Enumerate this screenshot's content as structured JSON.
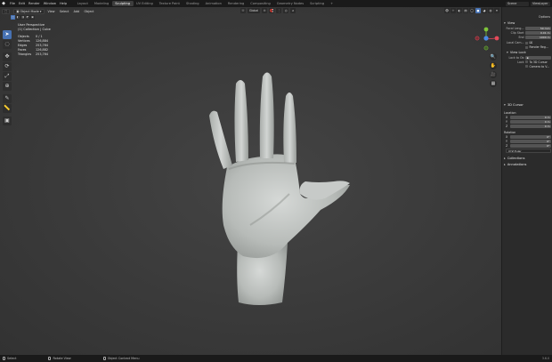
{
  "app": {
    "logo_glyph": "◆",
    "menu": [
      "File",
      "Edit",
      "Render",
      "Window",
      "Help"
    ],
    "workspaces": [
      "Layout",
      "Modeling",
      "Sculpting",
      "UV Editing",
      "Texture Paint",
      "Shading",
      "Animation",
      "Rendering",
      "Compositing",
      "Geometry Nodes",
      "Scripting"
    ],
    "active_workspace_index": 2,
    "add_workspace": "+",
    "scene": "Scene",
    "view_layer": "ViewLayer"
  },
  "viewport_header": {
    "mode": "Object Mode",
    "menus": [
      "View",
      "Select",
      "Add",
      "Object"
    ],
    "transform_orientation": "Global",
    "select_modes": [
      "▢",
      "◧",
      "◨",
      "◩",
      "▣"
    ]
  },
  "overlay": {
    "view_name": "User Perspective",
    "collection": "(1) Collection | Cube",
    "stats": [
      {
        "label": "Objects",
        "value": "0 / 1"
      },
      {
        "label": "Vertices",
        "value": "126,884"
      },
      {
        "label": "Edges",
        "value": "253,764"
      },
      {
        "label": "Faces",
        "value": "126,882"
      },
      {
        "label": "Triangles",
        "value": "253,764"
      }
    ]
  },
  "toolbar": [
    "➤",
    "◌",
    "✥",
    "⟳",
    "⤢",
    "⊕",
    "✎",
    "📏",
    "▣"
  ],
  "gizmo": {
    "x_color": "#e54a5a",
    "y_color": "#7fc43a",
    "z_color": "#4a8ae5"
  },
  "nav_buttons": [
    "🔍",
    "✋",
    "🎥",
    "▦"
  ],
  "npanel": {
    "options": "Options",
    "view": {
      "title": "View",
      "focal_length_label": "Focal Leng...",
      "focal_length": "50 mm",
      "clip_start_label": "Clip Start",
      "clip_start": "0.01 m",
      "clip_end_label": "End",
      "clip_end": "1000 m",
      "local_camera_label": "Local Cam...",
      "render_region": "Render Reg..."
    },
    "view_lock": {
      "title": "View Lock",
      "lock_to_object_label": "Lock to Ob",
      "lock_label": "Lock",
      "lock_3d_cursor": "To 3D Cursor",
      "camera_to_view": "Camera to V..."
    },
    "cursor": {
      "title": "3D Cursor",
      "location_label": "Location",
      "location": [
        {
          "axis": "X",
          "value": "0 m"
        },
        {
          "axis": "Y",
          "value": "0 m"
        },
        {
          "axis": "Z",
          "value": "0 m"
        }
      ],
      "rotation_label": "Rotation",
      "rotation": [
        {
          "axis": "X",
          "value": "0°"
        },
        {
          "axis": "Y",
          "value": "0°"
        },
        {
          "axis": "Z",
          "value": "0°"
        }
      ],
      "rotation_mode": "XYZ Euler"
    },
    "collections": "Collections",
    "annotations": "Annotations"
  },
  "statusbar": {
    "select": "Select",
    "rotate_view": "Rotate View",
    "context_menu": "Object Context Menu",
    "version": "3.6.0"
  }
}
